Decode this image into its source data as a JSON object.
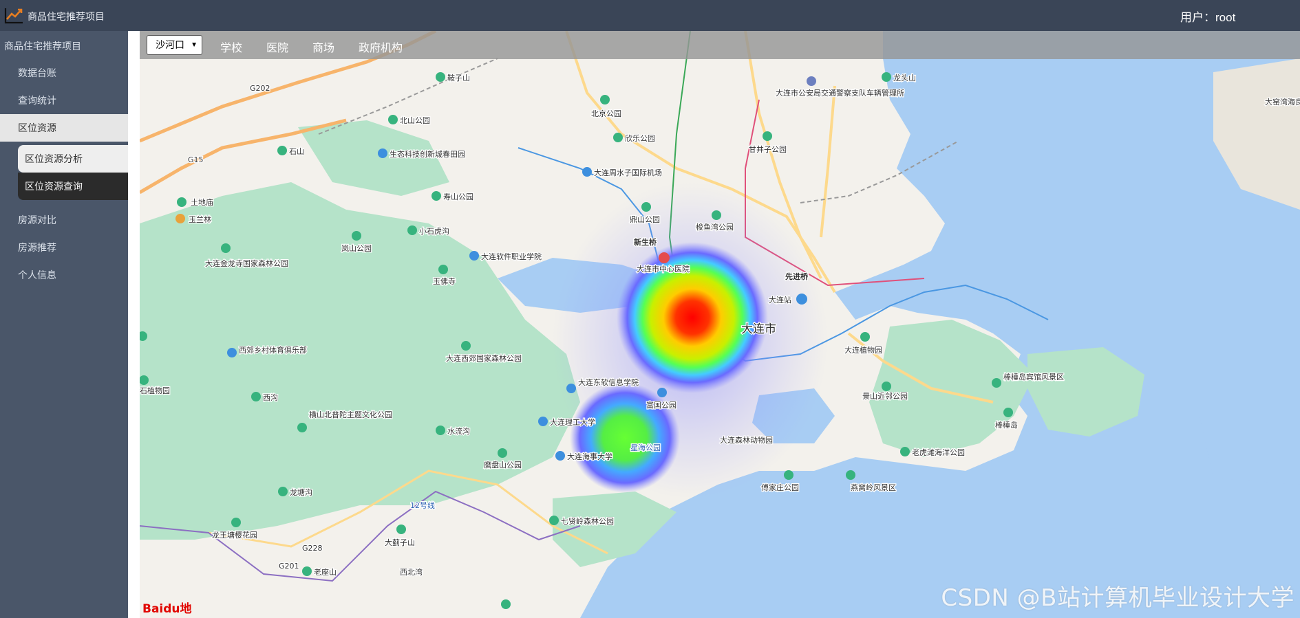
{
  "app": {
    "title": "商品住宅推荐项目",
    "user_label": "用户：root"
  },
  "sidebar": {
    "project_label": "商品住宅推荐项目",
    "items": [
      {
        "label": "数据台账"
      },
      {
        "label": "查询统计"
      },
      {
        "label": "区位资源",
        "active": true
      },
      {
        "label": "房源对比"
      },
      {
        "label": "房源推荐"
      },
      {
        "label": "个人信息"
      }
    ],
    "sub_items": [
      {
        "label": "区位资源分析",
        "selected": true
      },
      {
        "label": "区位资源查询"
      }
    ]
  },
  "map_toolbar": {
    "district_selected": "沙河口",
    "links": [
      "学校",
      "医院",
      "商场",
      "政府机构"
    ]
  },
  "map": {
    "labels": [
      "鞍子山",
      "北山公园",
      "石山",
      "生态科技创新城春田园",
      "土地庙",
      "玉兰林",
      "寿山公园",
      "大连金龙寺国家森林公园",
      "岚山公园",
      "小石虎沟",
      "大连软件职业学院",
      "玉佛寺",
      "北京公园",
      "欣乐公园",
      "大连周水子国际机场",
      "鼎山公园",
      "新生桥",
      "大连市中心医院",
      "梭鱼湾公园",
      "甘井子公园",
      "大连市公安局交通警察支队车辆管理所",
      "龙头山",
      "先进桥",
      "大连站",
      "大连市",
      "大连植物园",
      "西郊乡村体育俱乐部",
      "大连西郊国家森林公园",
      "西沟",
      "横山北普陀主题文化公园",
      "水流沟",
      "大连东软信息学院",
      "富国公园",
      "大连理工大学",
      "大连海事大学",
      "星海公园",
      "磨盘山公园",
      "大连森林动物园",
      "景山近邻公园",
      "棒棰岛宾馆风景区",
      "棒棰岛",
      "老虎滩海洋公园",
      "傅家庄公园",
      "燕窝岭风景区",
      "龙塘沟",
      "龙王塘樱花园",
      "大蓟子山",
      "七贤岭森林公园",
      "老座山",
      "石植物园",
      "西北湾",
      "大窑湾海良港办",
      "12号线",
      "G202",
      "G15",
      "G228",
      "G201"
    ],
    "attribution": "Baidu地图",
    "watermark": "CSDN @B站计算机毕业设计大学"
  },
  "colors": {
    "topbar": "#3a4557",
    "sidebar": "#4a5669",
    "water": "#a8cdf3",
    "greenery": "#b5e3c9",
    "land": "#f3f1ec"
  }
}
